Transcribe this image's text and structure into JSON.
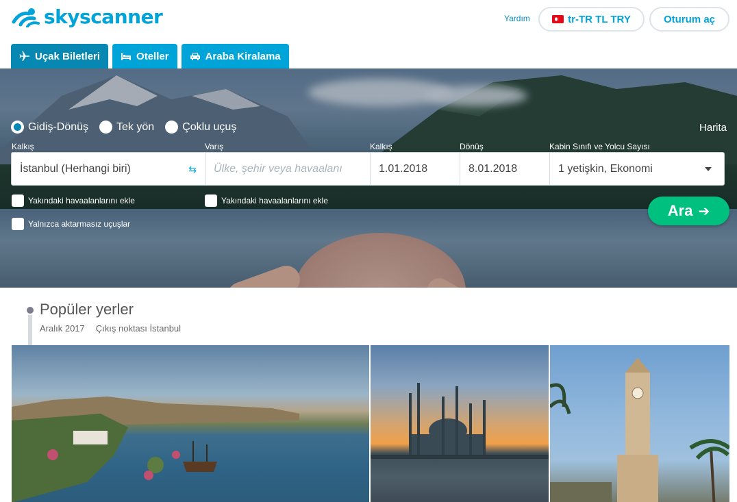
{
  "brand": {
    "name": "skyscanner"
  },
  "header": {
    "help": "Yardım",
    "locale": "tr-TR TL TRY",
    "login": "Oturum aç"
  },
  "tabs": [
    {
      "label": "Uçak Biletleri",
      "icon": "plane-icon",
      "active": true
    },
    {
      "label": "Oteller",
      "icon": "bed-icon",
      "active": false
    },
    {
      "label": "Araba Kiralama",
      "icon": "car-icon",
      "active": false
    }
  ],
  "trip_types": [
    {
      "label": "Gidiş-Dönüş",
      "selected": true
    },
    {
      "label": "Tek yön",
      "selected": false
    },
    {
      "label": "Çoklu uçuş",
      "selected": false
    }
  ],
  "map_link": "Harita",
  "search": {
    "from_label": "Kalkış",
    "from_value": "İstanbul (Herhangi biri)",
    "to_label": "Varış",
    "to_placeholder": "Ülke, şehir veya havaalanı",
    "depart_label": "Kalkış",
    "depart_value": "1.01.2018",
    "return_label": "Dönüş",
    "return_value": "8.01.2018",
    "cabin_label": "Kabin Sınıfı ve Yolcu Sayısı",
    "cabin_value": "1 yetişkin, Ekonomi",
    "nearby_from": "Yakındaki havaalanlarını ekle",
    "nearby_to": "Yakındaki havaalanlarını ekle",
    "direct_only": "Yalnızca aktarmasız uçuşlar",
    "button": "Ara"
  },
  "popular": {
    "title": "Popüler yerler",
    "month": "Aralık 2017",
    "origin": "Çıkış noktası İstanbul"
  },
  "colors": {
    "brand": "#00a4d8",
    "tab_active": "#0788b3",
    "search_button": "#00c07f"
  }
}
